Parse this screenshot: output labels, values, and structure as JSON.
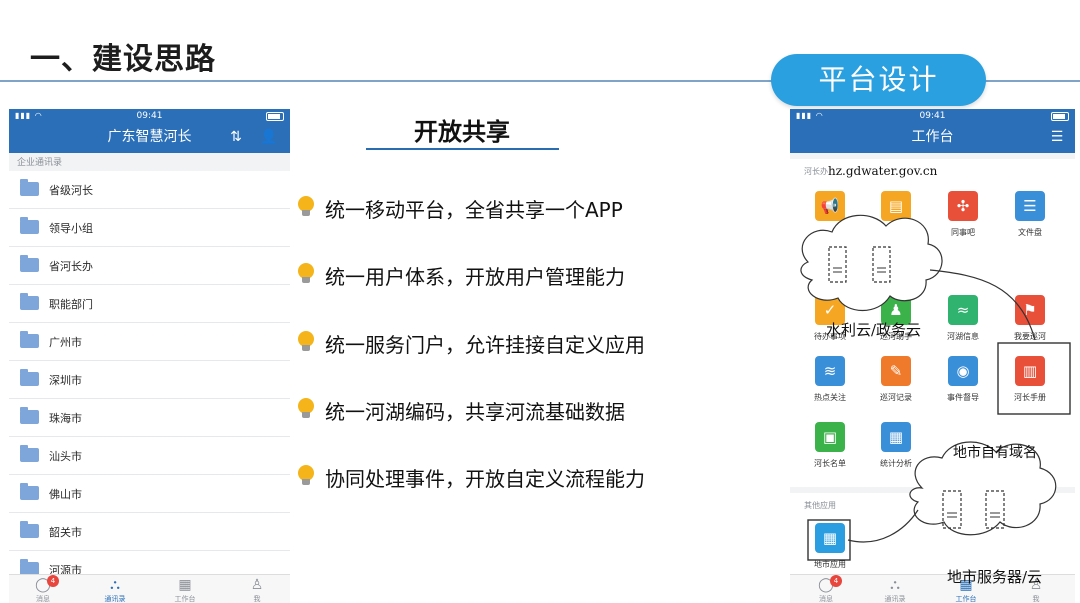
{
  "slide": {
    "title": "一、建设思路",
    "badge": "平台设计"
  },
  "left_phone": {
    "status_time": "09:41",
    "nav_title": "广东智慧河长",
    "section_label": "企业通讯录",
    "items": [
      "省级河长",
      "领导小组",
      "省河长办",
      "职能部门",
      "广州市",
      "深圳市",
      "珠海市",
      "汕头市",
      "佛山市",
      "韶关市",
      "河源市"
    ],
    "tabs": [
      "消息",
      "通讯录",
      "工作台",
      "我"
    ],
    "active_tab": "通讯录",
    "message_badge": "4"
  },
  "center": {
    "heading": "开放共享",
    "bullets": [
      "统一移动平台，全省共享一个APP",
      "统一用户体系，开放用户管理能力",
      "统一服务门户，允许挂接自定义应用",
      "统一河湖编码，共享河流基础数据",
      "协同处理事件，开放自定义流程能力"
    ]
  },
  "right_phone": {
    "status_time": "09:41",
    "nav_title": "工作台",
    "section1_label": "河长办",
    "section2_label": "其他应用",
    "apps": [
      {
        "label": "",
        "color": "#f5a623",
        "icon": "megaphone-icon"
      },
      {
        "label": "",
        "color": "#f5a623",
        "icon": "document-icon"
      },
      {
        "label": "同事吧",
        "color": "#e8503a",
        "icon": "network-icon"
      },
      {
        "label": "文件盘",
        "color": "#3a8fd9",
        "icon": "database-icon"
      },
      {
        "label": "待办事项",
        "color": "#f5a623",
        "icon": "todo-icon"
      },
      {
        "label": "巡河助手",
        "color": "#3bb24a",
        "icon": "person-icon"
      },
      {
        "label": "河湖信息",
        "color": "#2fb36f",
        "icon": "river-icon"
      },
      {
        "label": "我要巡河",
        "color": "#e8503a",
        "icon": "patrol-icon"
      },
      {
        "label": "热点关注",
        "color": "#3a8fd9",
        "icon": "wave-icon"
      },
      {
        "label": "巡河记录",
        "color": "#f07a2b",
        "icon": "record-icon"
      },
      {
        "label": "事件督导",
        "color": "#3a8fd9",
        "icon": "supervise-icon"
      },
      {
        "label": "河长手册",
        "color": "#e8503a",
        "icon": "manual-icon"
      },
      {
        "label": "河长名单",
        "color": "#3bb24a",
        "icon": "id-card-icon"
      },
      {
        "label": "统计分析",
        "color": "#3a8fd9",
        "icon": "chart-icon"
      }
    ],
    "other_app": {
      "label": "地市应用",
      "color": "#2a9ee0",
      "icon": "grid-icon"
    },
    "tabs": [
      "消息",
      "通讯录",
      "工作台",
      "我"
    ],
    "active_tab": "工作台",
    "message_badge": "4"
  },
  "annotations": {
    "domain": "hz.gdwater.gov.cn",
    "cloud1_label": "水利云/政务云",
    "cloud2_label": "地市服务器/云",
    "own_domain": "地市自有域名"
  }
}
